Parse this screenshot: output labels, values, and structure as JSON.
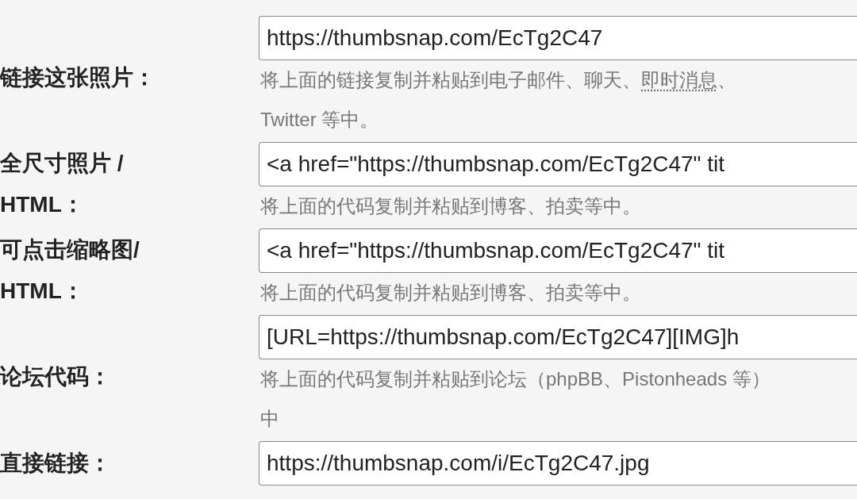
{
  "rows": [
    {
      "label": "链接这张照片：",
      "value": "https://thumbsnap.com/EcTg2C47",
      "hint": [
        {
          "text": "将上面的链接复制并粘贴到电子邮件、聊天、"
        },
        {
          "text": "即时消息",
          "dotted": true
        },
        {
          "text": "、Twitter 等中。"
        }
      ]
    },
    {
      "label": "全尺寸照片 / HTML：",
      "value": "<a href=\"https://thumbsnap.com/EcTg2C47\" tit",
      "hint": [
        {
          "text": "将上面的代码复制并粘贴到博客、拍卖等中。"
        }
      ]
    },
    {
      "label": "可点击缩略图/ HTML：",
      "value": "<a href=\"https://thumbsnap.com/EcTg2C47\" tit",
      "hint": [
        {
          "text": "将上面的代码复制并粘贴到博客、拍卖等中。"
        }
      ]
    },
    {
      "label": "论坛代码：",
      "value": "[URL=https://thumbsnap.com/EcTg2C47][IMG]h",
      "hint": [
        {
          "text": "将上面的代码复制并粘贴到论坛（phpBB、Pistonheads 等）中"
        }
      ]
    },
    {
      "label": "直接链接：",
      "value": "https://thumbsnap.com/i/EcTg2C47.jpg"
    }
  ]
}
